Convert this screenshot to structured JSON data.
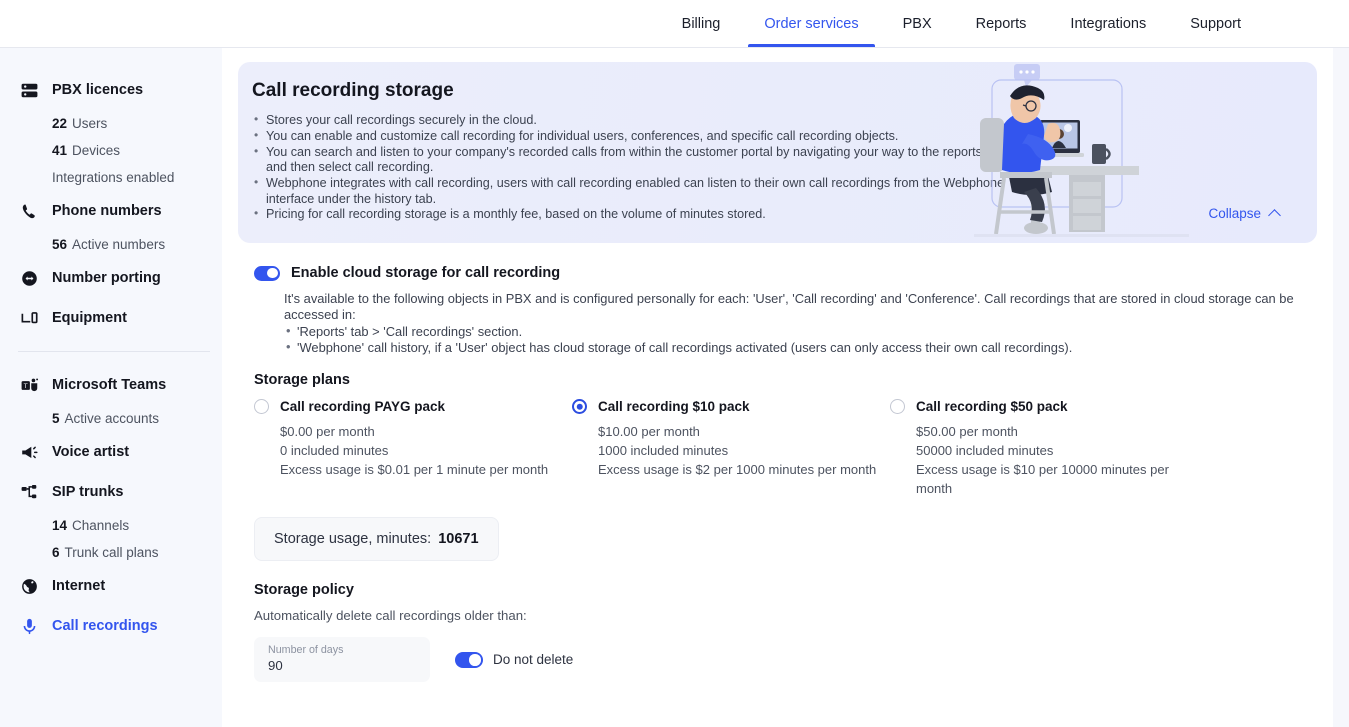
{
  "topnav": {
    "items": [
      {
        "label": "Billing",
        "active": false
      },
      {
        "label": "Order services",
        "active": true
      },
      {
        "label": "PBX",
        "active": false
      },
      {
        "label": "Reports",
        "active": false
      },
      {
        "label": "Integrations",
        "active": false
      },
      {
        "label": "Support",
        "active": false
      }
    ]
  },
  "sidebar": {
    "groups": [
      {
        "icon": "server-icon",
        "label": "PBX licences",
        "active": false,
        "subs": [
          {
            "num": "22",
            "text": "Users"
          },
          {
            "num": "41",
            "text": "Devices"
          },
          {
            "num": "",
            "text": "Integrations enabled"
          }
        ]
      },
      {
        "icon": "phone-icon",
        "label": "Phone numbers",
        "active": false,
        "subs": [
          {
            "num": "56",
            "text": "Active numbers"
          }
        ]
      },
      {
        "icon": "porting-icon",
        "label": "Number porting",
        "active": false,
        "subs": []
      },
      {
        "icon": "equipment-icon",
        "label": "Equipment",
        "active": false,
        "subs": []
      },
      {
        "divider": true
      },
      {
        "icon": "microsoft-teams-icon",
        "label": "Microsoft Teams",
        "active": false,
        "subs": [
          {
            "num": "5",
            "text": "Active accounts"
          }
        ]
      },
      {
        "icon": "megaphone-icon",
        "label": "Voice artist",
        "active": false,
        "subs": []
      },
      {
        "icon": "sip-trunk-icon",
        "label": "SIP trunks",
        "active": false,
        "subs": [
          {
            "num": "14",
            "text": "Channels"
          },
          {
            "num": "6",
            "text": "Trunk call plans"
          }
        ]
      },
      {
        "icon": "globe-icon",
        "label": "Internet",
        "active": false,
        "subs": []
      },
      {
        "icon": "microphone-icon",
        "label": "Call recordings",
        "active": true,
        "subs": []
      }
    ]
  },
  "banner": {
    "title": "Call recording storage",
    "bullets": [
      "Stores your call recordings securely in the cloud.",
      "You can enable and customize call recording for individual users, conferences, and specific call recording objects.",
      "You can search and listen to your company's recorded calls from within the customer portal by navigating your way to the reports tab, and then select call recording.",
      "Webphone integrates with call recording, users with call recording enabled can listen to their own call recordings from the Webphone interface under the history tab.",
      "Pricing for call recording storage is a monthly fee, based on the volume of minutes stored."
    ],
    "collapse_label": "Collapse",
    "illustration": "remote-worker-video-call-illustration"
  },
  "enable": {
    "title": "Enable cloud storage for call recording",
    "toggle_on": true,
    "paragraph": "It's available to the following objects in PBX and is configured personally for each: 'User', 'Call recording' and 'Conference'. Call recordings that are stored in cloud storage can be accessed in:",
    "bullets": [
      "'Reports' tab > 'Call recordings' section.",
      "'Webphone' call history, if a 'User' object has cloud storage of call recordings activated (users can only access their own call recordings)."
    ]
  },
  "plans_section": {
    "title": "Storage plans",
    "plans": [
      {
        "name": "Call recording PAYG pack",
        "selected": false,
        "price": "$0.00 per month",
        "included": "0 included minutes",
        "excess": "Excess usage is $0.01 per 1 minute per month"
      },
      {
        "name": "Call recording $10 pack",
        "selected": true,
        "price": "$10.00 per month",
        "included": "1000 included minutes",
        "excess": "Excess usage is $2 per 1000 minutes per month"
      },
      {
        "name": "Call recording $50 pack",
        "selected": false,
        "price": "$50.00 per month",
        "included": "50000 included minutes",
        "excess": "Excess usage is $10 per 10000 minutes per month"
      }
    ]
  },
  "usage": {
    "label": "Storage usage, minutes:",
    "value": "10671"
  },
  "policy": {
    "title": "Storage policy",
    "subtitle": "Automatically delete call recordings older than:",
    "field_label": "Number of days",
    "field_value": "90",
    "toggle_label": "Do not delete",
    "toggle_on": true
  },
  "colors": {
    "accent": "#3355ee",
    "radio_selected": "#2c4de0",
    "page_bg": "#f6f8fd",
    "banner_bg": "#eceefb"
  }
}
